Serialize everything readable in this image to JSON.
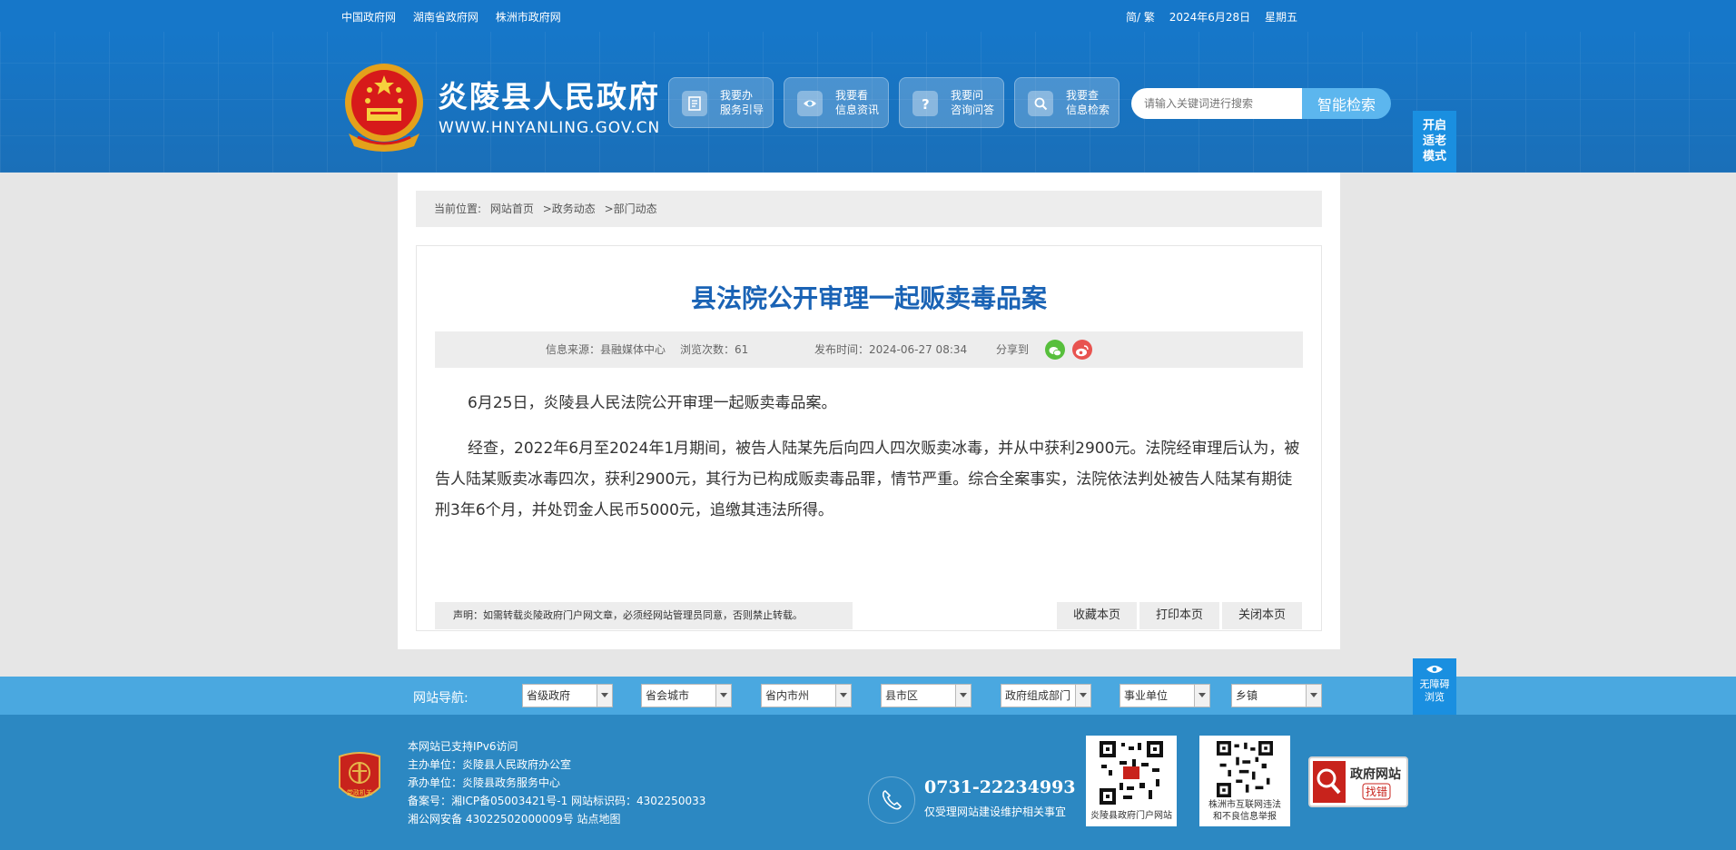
{
  "topbar": {
    "links": [
      "中国政府网",
      "湖南省政府网",
      "株洲市政府网"
    ],
    "lang": "简/ 繁",
    "date": "2024年6月28日",
    "weekday": "星期五"
  },
  "header": {
    "site_name": "炎陵县人民政府",
    "domain": "WWW.HNYANLING.GOV.CN",
    "services": [
      {
        "line1": "我要办",
        "line2": "服务引导",
        "icon": "document-icon"
      },
      {
        "line1": "我要看",
        "line2": "信息资讯",
        "icon": "eye-icon"
      },
      {
        "line1": "我要问",
        "line2": "咨询问答",
        "icon": "question-icon"
      },
      {
        "line1": "我要查",
        "line2": "信息检索",
        "icon": "search-icon"
      }
    ],
    "search_placeholder": "请输入关键词进行搜索",
    "search_button": "智能检索",
    "elder_mode": [
      "开启",
      "适老",
      "模式"
    ]
  },
  "breadcrumb": {
    "label": "当前位置:",
    "items": [
      "网站首页",
      ">政务动态",
      ">部门动态"
    ]
  },
  "article": {
    "title": "县法院公开审理一起贩卖毒品案",
    "source": "信息来源：县融媒体中心",
    "views": "浏览次数：61",
    "published": "发布时间：2024-06-27 08:34",
    "share_label": "分享到",
    "paragraphs": [
      "6月25日，炎陵县人民法院公开审理一起贩卖毒品案。",
      "经查，2022年6月至2024年1月期间，被告人陆某先后向四人四次贩卖冰毒，并从中获利2900元。法院经审理后认为，被告人陆某贩卖冰毒四次，获利2900元，其行为已构成贩卖毒品罪，情节严重。综合全案事实，法院依法判处被告人陆某有期徒刑3年6个月，并处罚金人民币5000元，追缴其违法所得。"
    ],
    "notice": "声明：如需转载炎陵政府门户网文章，必须经网站管理员同意，否则禁止转载。",
    "actions": [
      "收藏本页",
      "打印本页",
      "关闭本页"
    ]
  },
  "accessibility": [
    "无障碍",
    "浏览"
  ],
  "navbar": {
    "label": "网站导航:",
    "selects": [
      "省级政府",
      "省会城市",
      "省内市州",
      "县市区",
      "政府组成部门",
      "事业单位",
      "乡镇"
    ]
  },
  "footer": {
    "lines": [
      "本网站已支持IPv6访问",
      "主办单位：炎陵县人民政府办公室",
      "承办单位：炎陵县政务服务中心",
      "备案号：湘ICP备05003421号-1 网站标识码：4302250033",
      "湘公网安备 43022502000009号 站点地图"
    ],
    "phone": "0731-22234993",
    "phone_note": "仅受理网站建设维护相关事宜",
    "qr1_caption": "炎陵县政府门户网站",
    "qr2_caption": [
      "株洲市互联网违法",
      "和不良信息举报"
    ],
    "report_line1": "政府网站",
    "report_line2": "找错",
    "logo_text": "党政机关"
  },
  "colors": {
    "header_blue": "#1677c9",
    "title_blue": "#1a63b5",
    "footer_blue": "#2c88c2",
    "nav_blue": "#4aa8e0"
  }
}
